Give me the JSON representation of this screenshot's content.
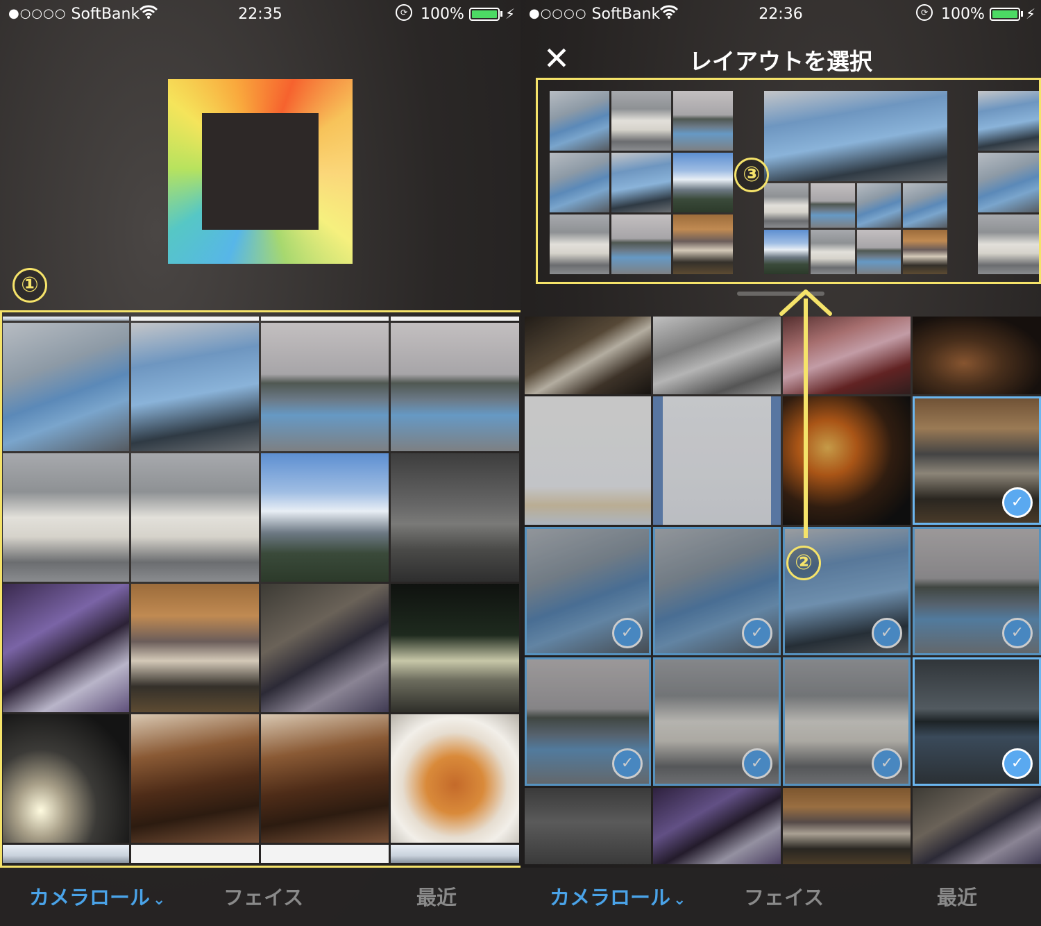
{
  "left": {
    "status": {
      "signal": "●○○○○",
      "carrier": "SoftBank",
      "time": "22:35",
      "battery": "100%"
    },
    "marker": "①",
    "tabs": {
      "camera_roll": "カメラロール",
      "faces": "フェイス",
      "recent": "最近"
    }
  },
  "right": {
    "status": {
      "signal": "●○○○○",
      "carrier": "SoftBank",
      "time": "22:36",
      "battery": "100%"
    },
    "title": "レイアウトを選択",
    "close": "✕",
    "marker_2": "②",
    "marker_3": "③",
    "tabs": {
      "camera_roll": "カメラロール",
      "faces": "フェイス",
      "recent": "最近"
    }
  },
  "colors": {
    "highlight": "#f5e36a",
    "accent": "#4aa3e8",
    "check": "#5aa9f0",
    "battery": "#4cd964"
  }
}
